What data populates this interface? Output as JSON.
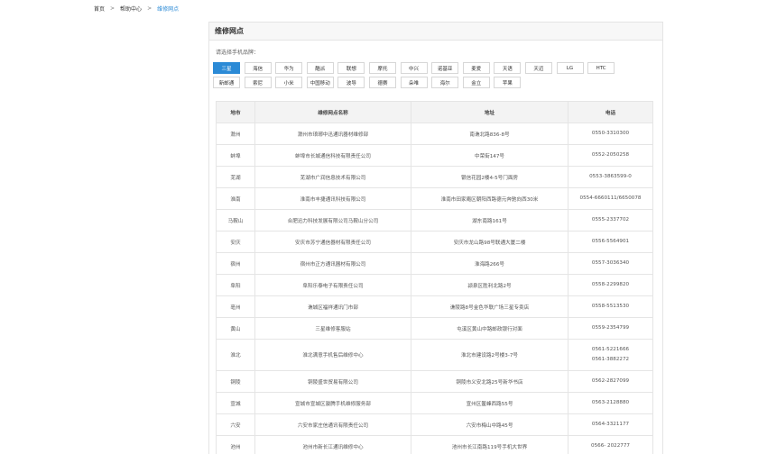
{
  "breadcrumb": {
    "home": "首页",
    "sep1": ">",
    "help": "帮助中心",
    "sep2": ">",
    "current": "维修网点"
  },
  "panel": {
    "title": "维修网点",
    "prompt": "请选择手机品牌："
  },
  "brand_rows": [
    [
      "三星",
      "海信",
      "华为",
      "酷派",
      "联想",
      "摩托",
      "中兴",
      "诺基亚",
      "麦爱",
      "天语",
      "天迈",
      "LG",
      "HTC"
    ],
    [
      "新邮通",
      "索尼",
      "小米",
      "中国移动",
      "波导",
      "德赛",
      "朵唯",
      "海尔",
      "金立",
      "苹果"
    ]
  ],
  "selected_brand": "三星",
  "accent_color": "#2b8ad6",
  "table": {
    "headers": [
      "地市",
      "维修网点名称",
      "地址",
      "电话"
    ],
    "rows": [
      {
        "city": "滁州",
        "name": "滁州市琅琊中迅通讯器材维修部",
        "address": "南谯北路836-8号",
        "phone": [
          "0550-3310300"
        ]
      },
      {
        "city": "蚌埠",
        "name": "蚌埠市长城通信科技有限责任公司",
        "address": "中荣街147号",
        "phone": [
          "0552-2050258"
        ]
      },
      {
        "city": "芜湖",
        "name": "芜湖市广润信息技术有限公司",
        "address": "银信花园2楼4-5号门面房",
        "phone": [
          "0553-3863599-0"
        ]
      },
      {
        "city": "淮南",
        "name": "淮南市丰捷通讯科技有限公司",
        "address": "淮南市田家庵区朝阳西路德元奔驰向西30米",
        "phone": [
          "0554-6660111/6650078"
        ]
      },
      {
        "city": "马鞍山",
        "name": "合肥迅力科技发展有限公司马鞍山分公司",
        "address": "湖东南路161号",
        "phone": [
          "0555-2337702"
        ]
      },
      {
        "city": "安庆",
        "name": "安庆市苏宁通信器材有限责任公司",
        "address": "安庆市龙山路98号联通大厦二楼",
        "phone": [
          "0556-5564901"
        ]
      },
      {
        "city": "宿州",
        "name": "宿州市正方通讯器材有限公司",
        "address": "淮海路266号",
        "phone": [
          "0557-3036340"
        ]
      },
      {
        "city": "阜阳",
        "name": "阜阳乐泰电子有限责任公司",
        "address": "颍泉区胜利北路2号",
        "phone": [
          "0558-2299820"
        ]
      },
      {
        "city": "亳州",
        "name": "谯城区福祥通讯门市部",
        "address": "谯陵路8号金色华联广场三星专卖店",
        "phone": [
          "0558-5513530"
        ]
      },
      {
        "city": "黄山",
        "name": "三星维修客服站",
        "address": "屯溪区黄山中路邮政银行对面",
        "phone": [
          "0559-2354799"
        ]
      },
      {
        "city": "淮北",
        "name": "淮北满意手机售后维修中心",
        "address": "淮北市建设路2号楼3-7号",
        "phone": [
          "0561-5221666",
          "0561-3882272"
        ]
      },
      {
        "city": "铜陵",
        "name": "铜陵盛世贸易有限公司",
        "address": "铜陵市义安北路25号新华书店",
        "phone": [
          "0562-2827099"
        ]
      },
      {
        "city": "宣城",
        "name": "宣城市宣城区骏腾手机维修服务部",
        "address": "宣州区鳌峰西路55号",
        "phone": [
          "0563-2128880"
        ]
      },
      {
        "city": "六安",
        "name": "六安市家庄信通讯有限责任公司",
        "address": "六安市梅山中路45号",
        "phone": [
          "0564-3321177"
        ]
      },
      {
        "city": "池州",
        "name": "池州市新长江通讯维修中心",
        "address": "池州市长江南路119号手机大世界",
        "phone": [
          "0566- 2022777"
        ]
      }
    ]
  }
}
